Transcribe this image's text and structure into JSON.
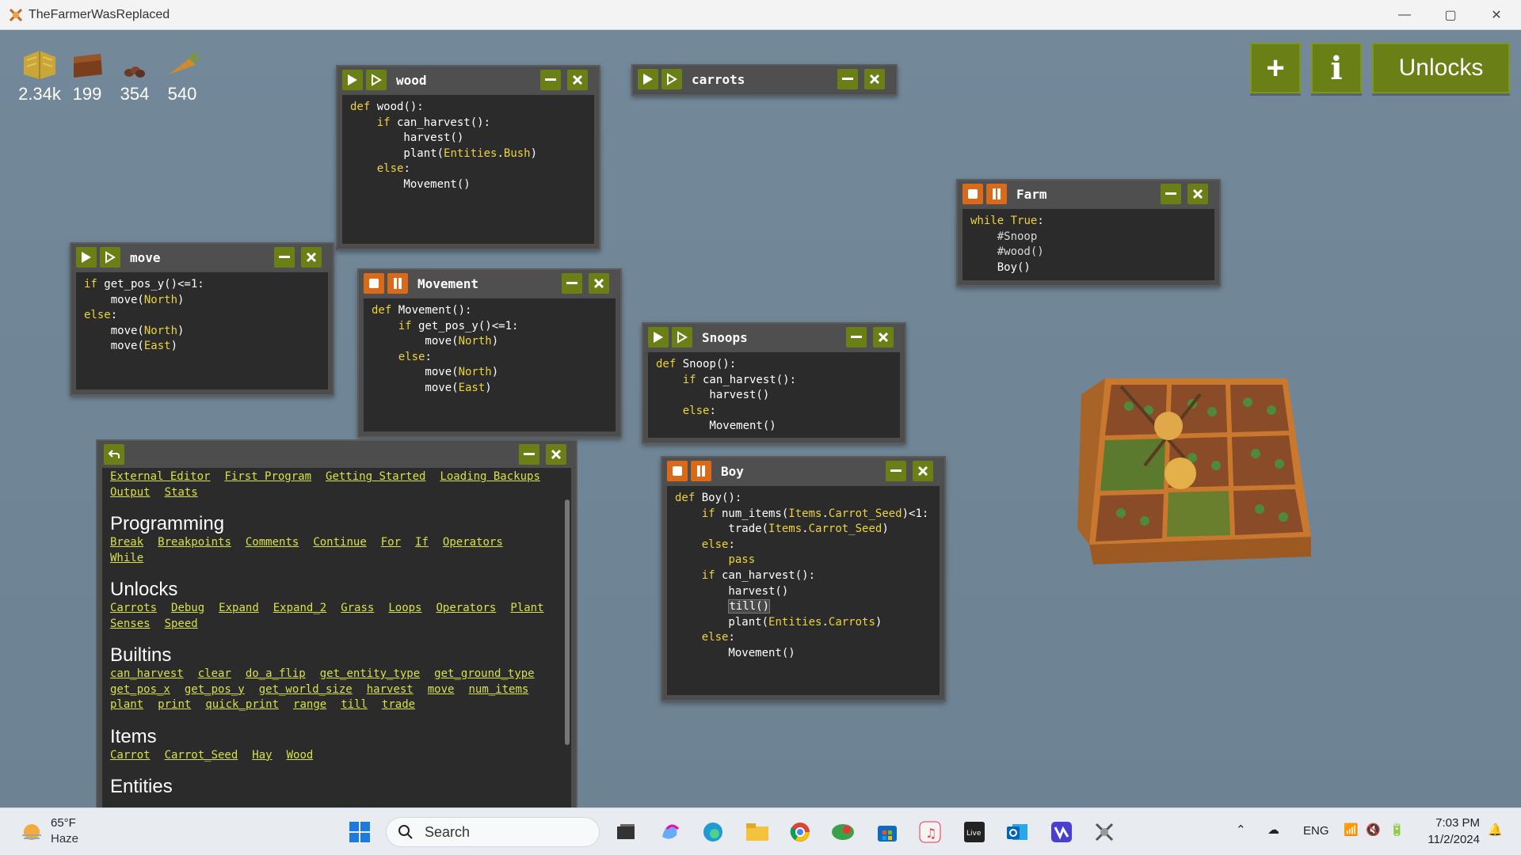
{
  "window": {
    "title": "TheFarmerWasReplaced",
    "min_icon": "minimize-icon",
    "max_icon": "maximize-icon",
    "close_icon": "close-icon"
  },
  "resources": [
    {
      "name": "hay",
      "value": "2.34k",
      "icon": "hay-icon",
      "color": "#c9a53a"
    },
    {
      "name": "wood",
      "value": "199",
      "icon": "wood-icon",
      "color": "#7a3e1c"
    },
    {
      "name": "carrot-seed",
      "value": "354",
      "icon": "seed-icon",
      "color": "#6b3a25"
    },
    {
      "name": "carrot",
      "value": "540",
      "icon": "carrot-icon",
      "color": "#d08a2e"
    }
  ],
  "top_buttons": {
    "add": "+",
    "info": "i",
    "unlocks": "Unlocks"
  },
  "windows": {
    "wood": {
      "name": "wood"
    },
    "carrots": {
      "name": "carrots"
    },
    "move": {
      "name": "move"
    },
    "movement": {
      "name": "Movement"
    },
    "snoops": {
      "name": "Snoops"
    },
    "farm": {
      "name": "Farm"
    },
    "boy": {
      "name": "Boy"
    }
  },
  "docs": {
    "top_links_1": [
      "External Editor",
      "First Program",
      "Getting Started",
      "Loading Backups"
    ],
    "top_links_2": [
      "Output",
      "Stats"
    ],
    "programming_title": "Programming",
    "programming": [
      "Break",
      "Breakpoints",
      "Comments",
      "Continue",
      "For",
      "If",
      "Operators",
      "While"
    ],
    "unlocks_title": "Unlocks",
    "unlocks": [
      "Carrots",
      "Debug",
      "Expand",
      "Expand_2",
      "Grass",
      "Loops",
      "Operators",
      "Plant",
      "Senses",
      "Speed"
    ],
    "builtins_title": "Builtins",
    "builtins": [
      "can_harvest",
      "clear",
      "do_a_flip",
      "get_entity_type",
      "get_ground_type",
      "get_pos_x",
      "get_pos_y",
      "get_world_size",
      "harvest",
      "move",
      "num_items",
      "plant",
      "print",
      "quick_print",
      "range",
      "till",
      "trade"
    ],
    "items_title": "Items",
    "items": [
      "Carrot",
      "Carrot_Seed",
      "Hay",
      "Wood"
    ],
    "entities_title": "Entities"
  },
  "taskbar": {
    "weather_temp": "65°F",
    "weather_desc": "Haze",
    "search_placeholder": "Search",
    "lang": "ENG",
    "time": "7:03 PM",
    "date": "11/2/2024"
  }
}
